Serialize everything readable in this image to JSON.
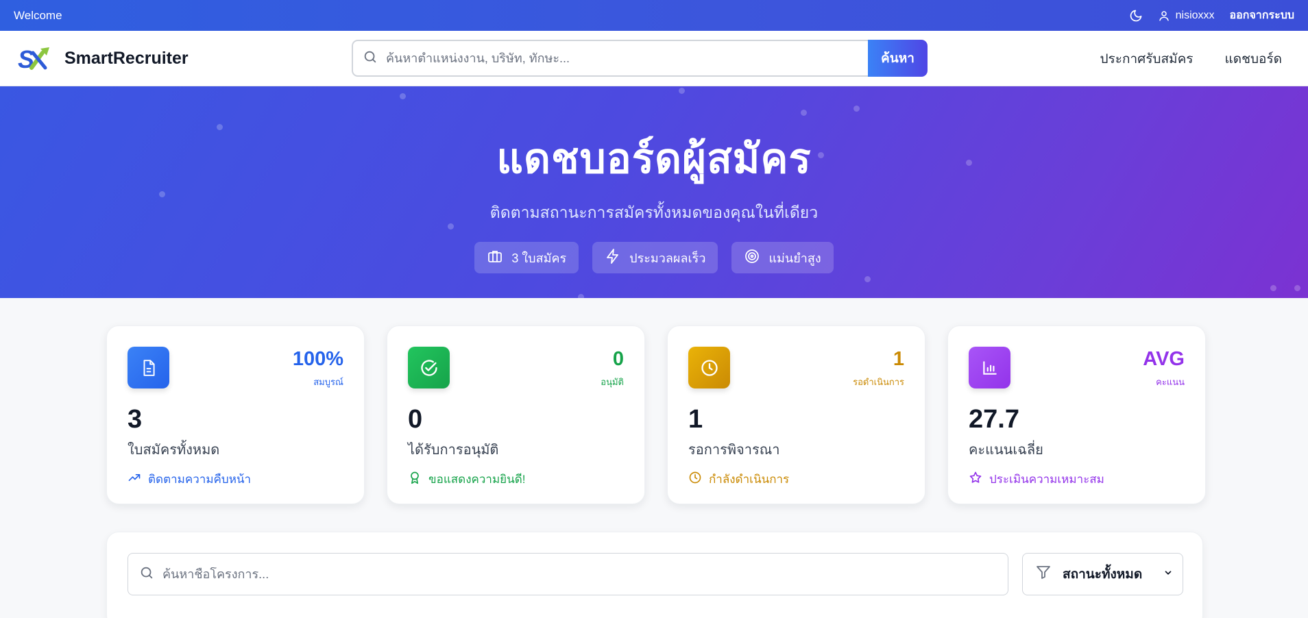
{
  "topbar": {
    "welcome": "Welcome",
    "theme_icon": "moon-icon",
    "username": "nisioxxx",
    "logout": "ออกจากระบบ"
  },
  "navbar": {
    "brand": "SmartRecruiter",
    "search_placeholder": "ค้นหาตำแหน่งงาน, บริษัท, ทักษะ...",
    "search_button": "ค้นหา",
    "links": [
      "ประกาศรับสมัคร",
      "แดชบอร์ด"
    ]
  },
  "hero": {
    "title": "แดชบอร์ดผู้สมัคร",
    "subtitle": "ติดตามสถานะการสมัครทั้งหมดของคุณในที่เดียว",
    "badges": [
      {
        "icon": "briefcase-icon",
        "label": "3 ใบสมัคร"
      },
      {
        "icon": "lightning-icon",
        "label": "ประมวลผลเร็ว"
      },
      {
        "icon": "target-icon",
        "label": "แม่นยำสูง"
      }
    ]
  },
  "stats": [
    {
      "icon": "document-icon",
      "top_value": "100%",
      "top_label": "สมบูรณ์",
      "number": "3",
      "label": "ใบสมัครทั้งหมด",
      "foot_icon": "trending-up-icon",
      "foot": "ติดตามความคืบหน้า",
      "color": "#2563eb"
    },
    {
      "icon": "check-circle-icon",
      "top_value": "0",
      "top_label": "อนุมัติ",
      "number": "0",
      "label": "ได้รับการอนุมัติ",
      "foot_icon": "award-icon",
      "foot": "ขอแสดงความยินดี!",
      "color": "#16a34a"
    },
    {
      "icon": "clock-icon",
      "top_value": "1",
      "top_label": "รอดำเนินการ",
      "number": "1",
      "label": "รอการพิจารณา",
      "foot_icon": "clock-icon",
      "foot": "กำลังดำเนินการ",
      "color": "#ca8a04"
    },
    {
      "icon": "bar-chart-icon",
      "top_value": "AVG",
      "top_label": "คะแนน",
      "number": "27.7",
      "label": "คะแนนเฉลี่ย",
      "foot_icon": "star-icon",
      "foot": "ประเมินความเหมาะสม",
      "color": "#9333ea"
    }
  ],
  "filters": {
    "search_placeholder": "ค้นหาชื่อโครงการ...",
    "status_value": "สถานะทั้งหมด"
  }
}
